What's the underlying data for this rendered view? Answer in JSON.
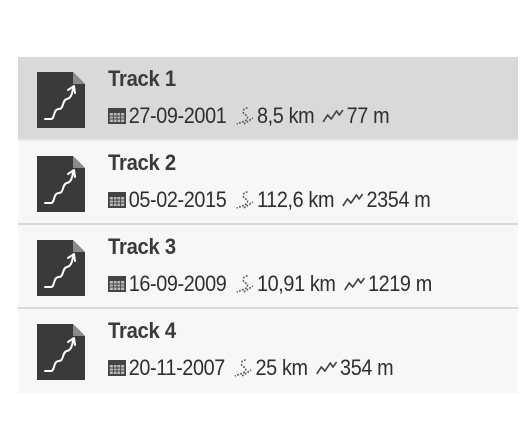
{
  "tracks": [
    {
      "name": "Track 1",
      "date": "27-09-2001",
      "distance": "8,5 km",
      "elevation": "77 m",
      "selected": true
    },
    {
      "name": "Track 2",
      "date": "05-02-2015",
      "distance": "112,6 km",
      "elevation": "2354 m",
      "selected": false
    },
    {
      "name": "Track 3",
      "date": "16-09-2009",
      "distance": "10,91 km",
      "elevation": "1219 m",
      "selected": false
    },
    {
      "name": "Track 4",
      "date": "20-11-2007",
      "distance": "25 km",
      "elevation": "354 m",
      "selected": false
    }
  ],
  "icons": {
    "thumbnail": "track-file-icon",
    "date": "calendar-icon",
    "distance": "route-distance-icon",
    "elevation": "elevation-icon"
  },
  "colors": {
    "selected_row": "#d9d9d9",
    "row": "#f7f7f7",
    "icon": "#3a3a3a",
    "text": "#2e2e2e"
  }
}
